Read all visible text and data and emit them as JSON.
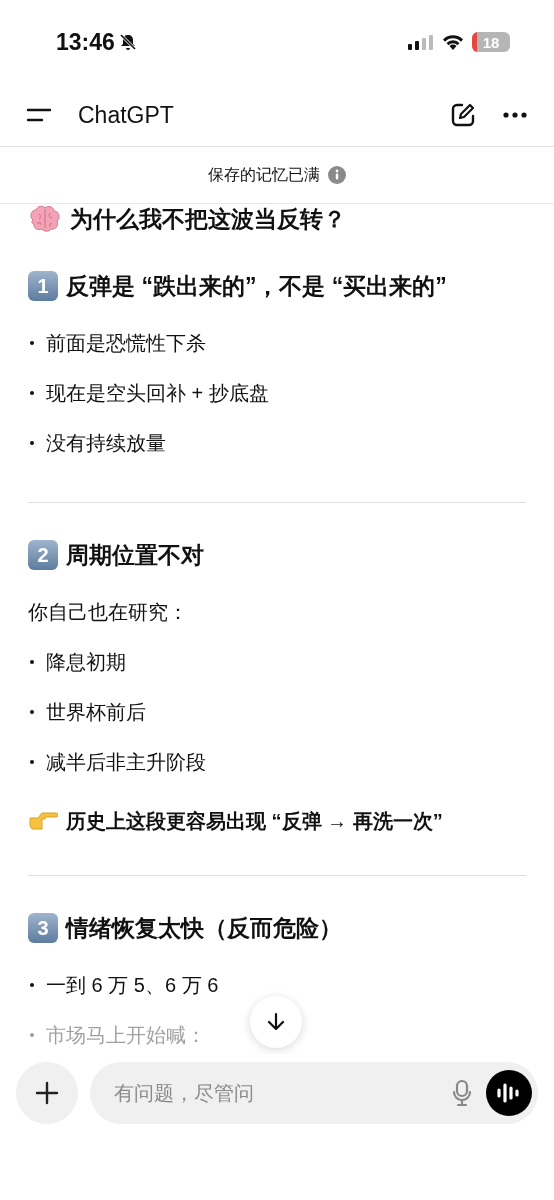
{
  "status_bar": {
    "time": "13:46",
    "battery": "18"
  },
  "header": {
    "title": "ChatGPT"
  },
  "notice": {
    "text": "保存的记忆已满"
  },
  "blocks": [
    {
      "kind": "title",
      "text": "为什么我不把这波当反转？"
    },
    {
      "kind": "section",
      "number": "1",
      "text": "反弹是 “跌出来的”，不是 “买出来的”"
    },
    {
      "kind": "bullet",
      "text": "前面是恐慌性下杀",
      "faded": false
    },
    {
      "kind": "bullet",
      "text": "现在是空头回补 + 抄底盘",
      "faded": false
    },
    {
      "kind": "bullet",
      "text": "没有持续放量",
      "faded": false
    },
    {
      "kind": "divider"
    },
    {
      "kind": "section",
      "number": "2",
      "text": "周期位置不对"
    },
    {
      "kind": "paragraph",
      "text": "你自己也在研究："
    },
    {
      "kind": "bullet",
      "text": "降息初期",
      "faded": false
    },
    {
      "kind": "bullet",
      "text": "世界杯前后",
      "faded": false
    },
    {
      "kind": "bullet",
      "text": "减半后非主升阶段",
      "faded": false
    },
    {
      "kind": "callout",
      "text": "历史上这段更容易出现 “反弹 → 再洗一次”"
    },
    {
      "kind": "divider"
    },
    {
      "kind": "section",
      "number": "3",
      "text": "情绪恢复太快（反而危险）"
    },
    {
      "kind": "bullet",
      "text": "一到 6 万 5、6 万 6",
      "faded": false
    },
    {
      "kind": "bullet",
      "text": "市场马上开始喊：",
      "faded": true
    }
  ],
  "composer": {
    "placeholder": "有问题，尽管问"
  }
}
